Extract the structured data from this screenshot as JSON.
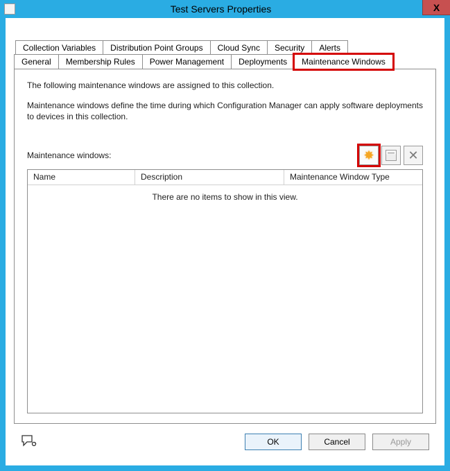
{
  "window": {
    "title": "Test Servers Properties",
    "close_label": "X"
  },
  "tabs": {
    "row1": [
      "Collection Variables",
      "Distribution Point Groups",
      "Cloud Sync",
      "Security",
      "Alerts"
    ],
    "row2": [
      "General",
      "Membership Rules",
      "Power Management",
      "Deployments",
      "Maintenance Windows"
    ],
    "active": "Maintenance Windows"
  },
  "page": {
    "intro1": "The following maintenance windows are assigned to this collection.",
    "intro2": "Maintenance windows define the time during which Configuration Manager can apply software deployments to devices in this collection.",
    "list_label": "Maintenance windows:",
    "toolbar": {
      "new": "new-starburst",
      "edit": "calendar-schedule",
      "delete": "delete-x"
    },
    "columns": [
      "Name",
      "Description",
      "Maintenance Window Type"
    ],
    "empty_text": "There are no items to show in this view.",
    "rows": []
  },
  "footer": {
    "ok": "OK",
    "cancel": "Cancel",
    "apply": "Apply"
  }
}
